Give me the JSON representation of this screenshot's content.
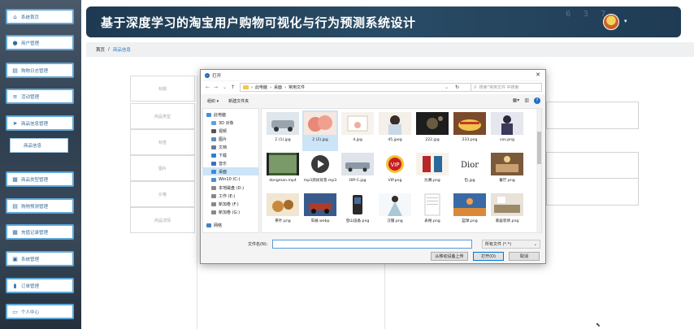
{
  "sidebar": {
    "items": [
      {
        "label": "系统首页",
        "icon": "home-icon"
      },
      {
        "label": "用户管理",
        "icon": "pin-icon"
      },
      {
        "label": "购物日志管理",
        "icon": "list-icon"
      },
      {
        "label": "活动管理",
        "icon": "menu-icon"
      },
      {
        "label": "商品信息管理",
        "icon": "send-icon"
      },
      {
        "label": "商品类型管理",
        "icon": "grid-icon"
      },
      {
        "label": "购物预测管理",
        "icon": "list-icon"
      },
      {
        "label": "充值记录管理",
        "icon": "grid-icon"
      },
      {
        "label": "系统管理",
        "icon": "calendar-icon"
      },
      {
        "label": "订单管理",
        "icon": "bar-chart-icon"
      },
      {
        "label": "个人中心",
        "icon": "window-icon"
      }
    ],
    "sub_item": "商品信息"
  },
  "header": {
    "title": "基于深度学习的淘宝用户购物可视化与行为预测系统设计",
    "deco": "6 3 7",
    "caret": "▾"
  },
  "breadcrumb": {
    "home": "首页",
    "separator": "/",
    "current": "商品信息"
  },
  "form_bg": {
    "labels": [
      "标题",
      "商品类型",
      "标签",
      "图片",
      "价格",
      "商品详情"
    ]
  },
  "dialog": {
    "title": "打开",
    "close": "✕",
    "path": [
      "此电脑",
      "桌面",
      "常用文件"
    ],
    "search_placeholder": "搜索\"常用文件 中搜索",
    "toolbar": {
      "organize": "组织 ▾",
      "new_folder": "新建文件夹"
    },
    "nav": [
      {
        "label": "此电脑",
        "color": "#4a8fd6"
      },
      {
        "label": "3D 对象",
        "color": "#5aa0e6"
      },
      {
        "label": "视频",
        "color": "#555555"
      },
      {
        "label": "图片",
        "color": "#5a8fc0"
      },
      {
        "label": "文档",
        "color": "#6a7a90"
      },
      {
        "label": "下载",
        "color": "#2a80d0"
      },
      {
        "label": "音乐",
        "color": "#3a70c0"
      },
      {
        "label": "桌面",
        "color": "#3a8ad6"
      },
      {
        "label": "Win10 (C:)",
        "color": "#4a90d0"
      },
      {
        "label": "本地磁盘 (D:)",
        "color": "#888888"
      },
      {
        "label": "工作 (E:)",
        "color": "#888888"
      },
      {
        "label": "新加卷 (F:)",
        "color": "#888888"
      },
      {
        "label": "新加卷 (G:)",
        "color": "#888888"
      },
      {
        "label": "网络",
        "color": "#4a80c0"
      }
    ],
    "files": [
      {
        "name": "2 (1).jpg",
        "colors": [
          "#dfe6ec",
          "#9aa4ad"
        ]
      },
      {
        "name": "2 (2).jpg",
        "colors": [
          "#f1b2a6",
          "#d8665a"
        ]
      },
      {
        "name": "4.jpg",
        "colors": [
          "#f6f3ee",
          "#d9c9b3"
        ]
      },
      {
        "name": "45.jpeg",
        "colors": [
          "#f4efe9",
          "#c9a7a0"
        ]
      },
      {
        "name": "222.jpg",
        "colors": [
          "#1d1d1d",
          "#6a5a40"
        ]
      },
      {
        "name": "233.png",
        "colors": [
          "#7a4a2a",
          "#f2c44a"
        ]
      },
      {
        "name": "cos.png",
        "colors": [
          "#2a2a3a",
          "#6a6a90"
        ]
      },
      {
        "name": "dongman.mp4",
        "colors": [
          "#7a9a6a",
          "#3a5a30"
        ]
      },
      {
        "name": "mp3测试背景.mp3",
        "colors": [
          "#f2f2f2",
          "#3a3a3a"
        ]
      },
      {
        "name": "OIP-C.jpg",
        "colors": [
          "#dfe4ea",
          "#8a98a8"
        ]
      },
      {
        "name": "VIP.png",
        "colors": [
          "#c81e1e",
          "#f2c23a"
        ]
      },
      {
        "name": "比赛.png",
        "colors": [
          "#f7f3ea",
          "#b82828"
        ]
      },
      {
        "name": "包.jpg",
        "colors": [
          "#ffffff",
          "#222222"
        ]
      },
      {
        "name": "餐厅.png",
        "colors": [
          "#7a5a3a",
          "#c9a070"
        ]
      },
      {
        "name": "茶叶.png",
        "colors": [
          "#f0e6d2",
          "#c88a3a"
        ]
      },
      {
        "name": "车展.webp",
        "colors": [
          "#3a5a8a",
          "#b03a2a"
        ]
      },
      {
        "name": "登山设备.png",
        "colors": [
          "#2a2a2a",
          "#4a6a9a"
        ]
      },
      {
        "name": "汉服.png",
        "colors": [
          "#f4f8fa",
          "#aac8d6"
        ]
      },
      {
        "name": "表格.png",
        "colors": [
          "#ffffff",
          "#c8c8c8"
        ]
      },
      {
        "name": "篮球.png",
        "colors": [
          "#d88a3a",
          "#3a6aa6"
        ]
      },
      {
        "name": "家居装修.png",
        "colors": [
          "#e8e2d8",
          "#9a8a6a"
        ]
      }
    ],
    "vip_text": "VIP",
    "dior_text": "Dior",
    "filename_label": "文件名(N):",
    "filetype": "所有文件 (*.*)",
    "btn_upload": "从移动设备上传",
    "btn_open": "打开(O)",
    "btn_cancel": "取消"
  }
}
